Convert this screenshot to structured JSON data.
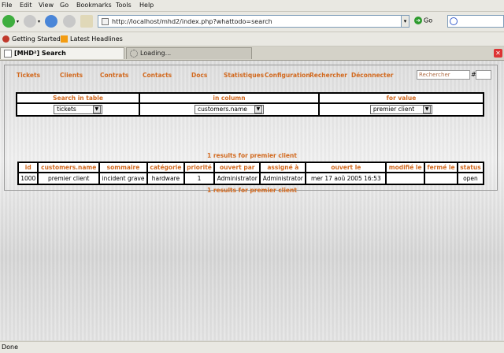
{
  "browser": {
    "menu": [
      "File",
      "Edit",
      "View",
      "Go",
      "Bookmarks",
      "Tools",
      "Help"
    ],
    "url": "http://localhost/mhd2/index.php?whattodo=search",
    "go_label": "Go",
    "bookmarks": [
      "Getting Started",
      "Latest Headlines"
    ],
    "tabs": [
      {
        "label": "[MHD²] Search",
        "active": true
      },
      {
        "label": "Loading...",
        "active": false
      }
    ],
    "status": "Done"
  },
  "nav": {
    "items": [
      "Tickets",
      "Clients",
      "Contrats",
      "Contacts",
      "Docs",
      "Statistiques",
      "Configuration",
      "Rechercher",
      "Déconnecter"
    ],
    "search_placeholder": "Rechercher",
    "hash": "#"
  },
  "search": {
    "headers": [
      "Search in table",
      "in column",
      "for value"
    ],
    "table_value": "tickets",
    "column_value": "customers.name",
    "value_value": "premier client"
  },
  "results": {
    "count_text": "1 results for premier client",
    "headers": [
      "id",
      "customers.name",
      "sommaire",
      "catégorie",
      "priorité",
      "ouvert par",
      "assigné à",
      "ouvert le",
      "modifié le",
      "fermé le",
      "status"
    ],
    "rows": [
      [
        "1000",
        "premier client",
        "incident grave",
        "hardware",
        "1",
        "Administrator",
        "Administrator",
        "mer 17 aoû 2005 16:53",
        "",
        "",
        "open"
      ]
    ]
  },
  "colors": {
    "accent": "#d2691e"
  }
}
